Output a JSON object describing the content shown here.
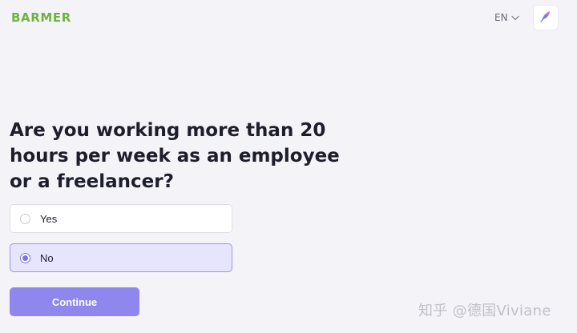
{
  "header": {
    "logo_text": "BARMER",
    "language": "EN",
    "feedback_icon": "feather-icon"
  },
  "question": {
    "text": "Are you working more than 20 hours per week as an employee or a freelancer?"
  },
  "options": [
    {
      "label": "Yes",
      "selected": false
    },
    {
      "label": "No",
      "selected": true
    }
  ],
  "continue_label": "Continue",
  "watermark": "知乎 @德国Viviane",
  "colors": {
    "brand_green": "#6db33f",
    "accent_purple": "#8f86ee",
    "selected_bg": "#e7e4fd",
    "page_bg": "#f4f3f8"
  }
}
